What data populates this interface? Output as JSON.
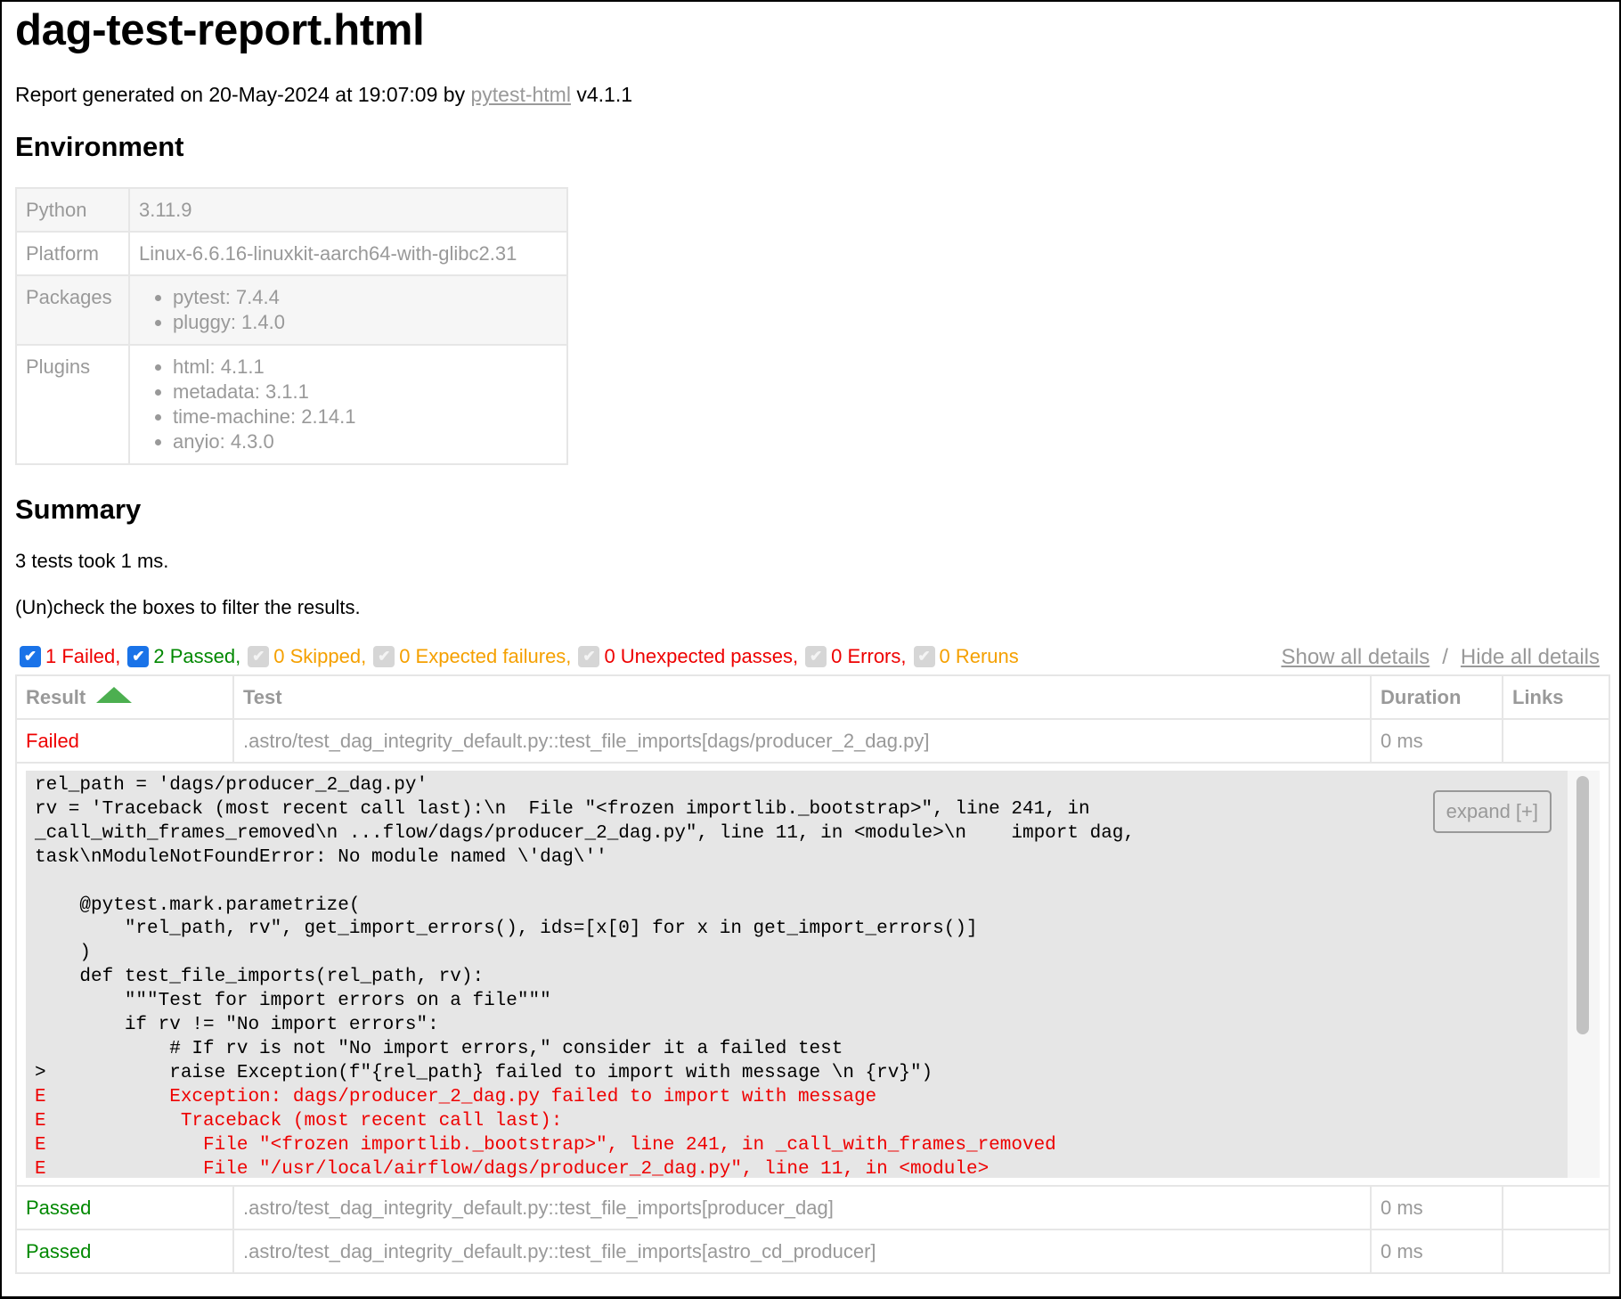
{
  "title": "dag-test-report.html",
  "generated": {
    "prefix": "Report generated on 20-May-2024 at 19:07:09 by ",
    "link_label": "pytest-html",
    "suffix": " v4.1.1"
  },
  "environment": {
    "heading": "Environment",
    "rows": [
      {
        "key": "Python",
        "value": "3.11.9"
      },
      {
        "key": "Platform",
        "value": "Linux-6.6.16-linuxkit-aarch64-with-glibc2.31"
      },
      {
        "key": "Packages",
        "items": [
          "pytest: 7.4.4",
          "pluggy: 1.4.0"
        ]
      },
      {
        "key": "Plugins",
        "items": [
          "html: 4.1.1",
          "metadata: 3.1.1",
          "time-machine: 2.14.1",
          "anyio: 4.3.0"
        ]
      }
    ]
  },
  "summary": {
    "heading": "Summary",
    "duration_text": "3 tests took 1 ms.",
    "filter_hint": "(Un)check the boxes to filter the results.",
    "filters": [
      {
        "label": "1 Failed,",
        "checked": true,
        "enabled": true,
        "color": "#ee0000"
      },
      {
        "label": "2 Passed,",
        "checked": true,
        "enabled": true,
        "color": "#008800"
      },
      {
        "label": "0 Skipped,",
        "checked": true,
        "enabled": false,
        "color": "#f5a000"
      },
      {
        "label": "0 Expected failures,",
        "checked": true,
        "enabled": false,
        "color": "#f5a000"
      },
      {
        "label": "0 Unexpected passes,",
        "checked": true,
        "enabled": false,
        "color": "#ee0000"
      },
      {
        "label": "0 Errors,",
        "checked": true,
        "enabled": false,
        "color": "#ee0000"
      },
      {
        "label": "0 Reruns",
        "checked": true,
        "enabled": false,
        "color": "#f5a000"
      }
    ],
    "show_all": "Show all details",
    "separator": "/",
    "hide_all": "Hide all details"
  },
  "results": {
    "columns": [
      "Result",
      "Test",
      "Duration",
      "Links"
    ],
    "sort_icon": "sort-ascending-icon",
    "rows": [
      {
        "result": "Failed",
        "test": ".astro/test_dag_integrity_default.py::test_file_imports[dags/producer_2_dag.py]",
        "duration": "0 ms",
        "links": ""
      },
      {
        "result": "Passed",
        "test": ".astro/test_dag_integrity_default.py::test_file_imports[producer_dag]",
        "duration": "0 ms",
        "links": ""
      },
      {
        "result": "Passed",
        "test": ".astro/test_dag_integrity_default.py::test_file_imports[astro_cd_producer]",
        "duration": "0 ms",
        "links": ""
      }
    ],
    "log": {
      "expand_label": "expand [+]",
      "lines": [
        {
          "text": "rel_path = 'dags/producer_2_dag.py'",
          "error": false
        },
        {
          "text": "rv = 'Traceback (most recent call last):\\n  File \"<frozen importlib._bootstrap>\", line 241, in",
          "error": false
        },
        {
          "text": "_call_with_frames_removed\\n ...flow/dags/producer_2_dag.py\", line 11, in <module>\\n    import dag,",
          "error": false
        },
        {
          "text": "task\\nModuleNotFoundError: No module named \\'dag\\''",
          "error": false
        },
        {
          "text": "",
          "error": false
        },
        {
          "text": "    @pytest.mark.parametrize(",
          "error": false
        },
        {
          "text": "        \"rel_path, rv\", get_import_errors(), ids=[x[0] for x in get_import_errors()]",
          "error": false
        },
        {
          "text": "    )",
          "error": false
        },
        {
          "text": "    def test_file_imports(rel_path, rv):",
          "error": false
        },
        {
          "text": "        \"\"\"Test for import errors on a file\"\"\"",
          "error": false
        },
        {
          "text": "        if rv != \"No import errors\":",
          "error": false
        },
        {
          "text": "            # If rv is not \"No import errors,\" consider it a failed test",
          "error": false
        },
        {
          "text": ">           raise Exception(f\"{rel_path} failed to import with message \\n {rv}\")",
          "error": false
        },
        {
          "text": "E           Exception: dags/producer_2_dag.py failed to import with message",
          "error": true
        },
        {
          "text": "E            Traceback (most recent call last):",
          "error": true
        },
        {
          "text": "E              File \"<frozen importlib._bootstrap>\", line 241, in _call_with_frames_removed",
          "error": true
        },
        {
          "text": "E              File \"/usr/local/airflow/dags/producer_2_dag.py\", line 11, in <module>",
          "error": true
        }
      ]
    }
  }
}
